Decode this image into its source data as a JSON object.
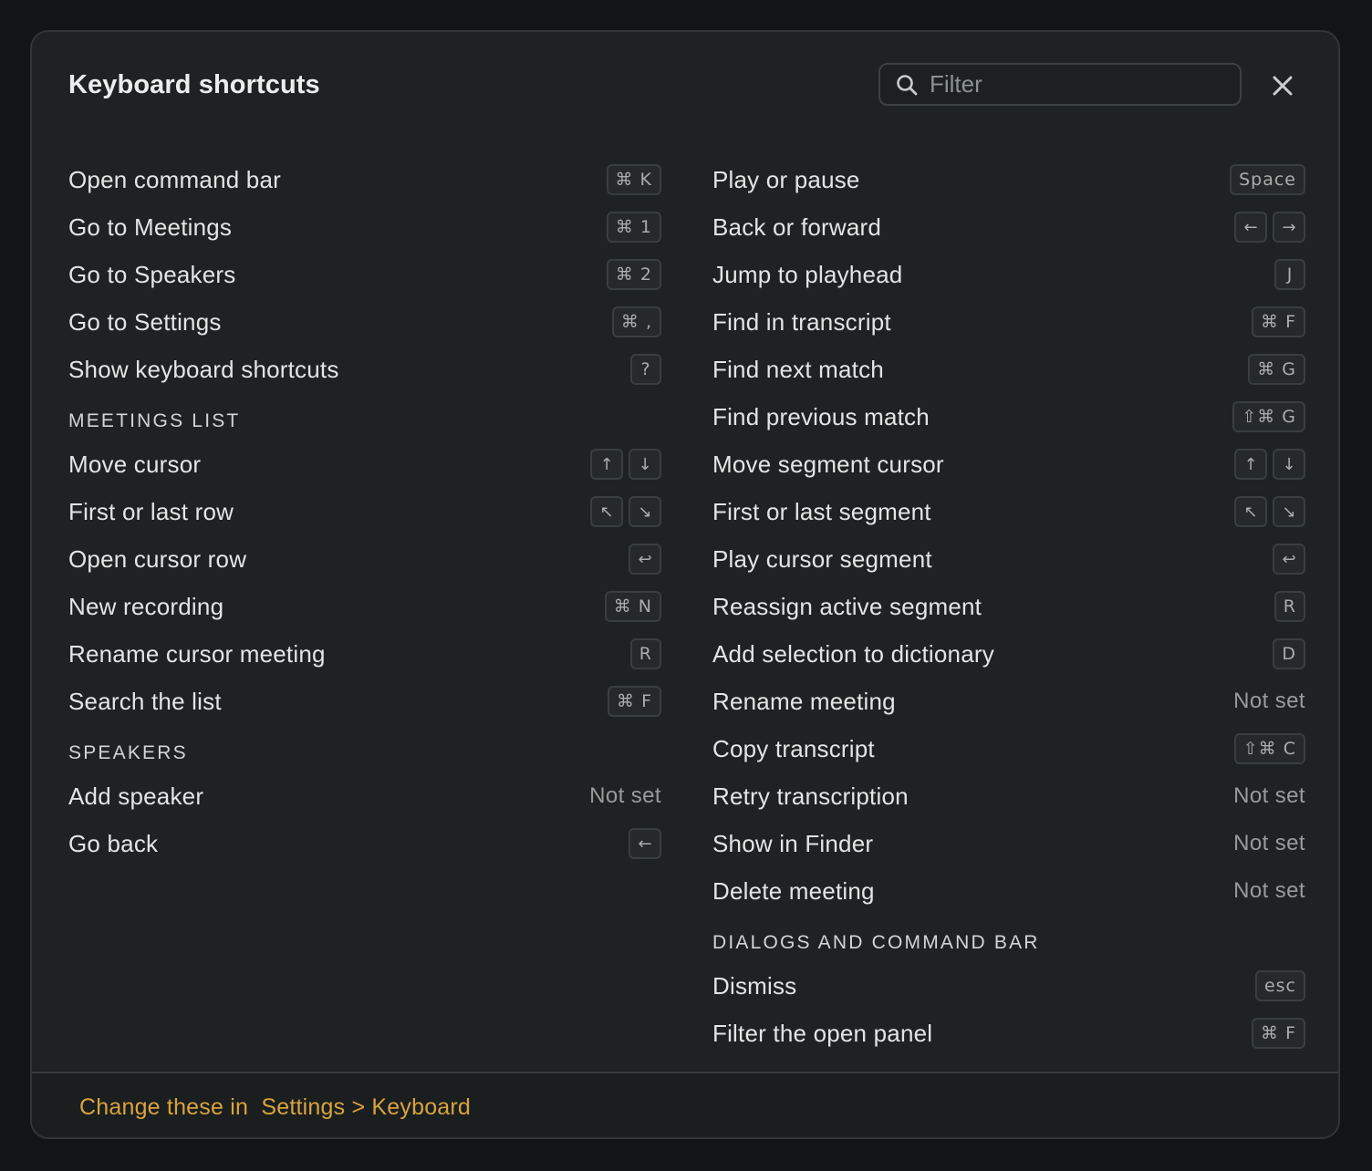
{
  "dialog": {
    "title": "Keyboard shortcuts",
    "filter_placeholder": "Filter",
    "close_icon": "close-icon",
    "search_icon": "search-icon"
  },
  "left_column": {
    "general": [
      {
        "action": "Open command bar",
        "keys": [
          "⌘ K"
        ]
      },
      {
        "action": "Go to Meetings",
        "keys": [
          "⌘ 1"
        ]
      },
      {
        "action": "Go to Speakers",
        "keys": [
          "⌘ 2"
        ]
      },
      {
        "action": "Go to Settings",
        "keys": [
          "⌘ ,"
        ]
      },
      {
        "action": "Show keyboard shortcuts",
        "keys": [
          "?"
        ]
      }
    ],
    "meetings_list": {
      "header": "MEETINGS LIST",
      "items": [
        {
          "action": "Move cursor",
          "keys": [
            "↑",
            "↓"
          ]
        },
        {
          "action": "First or last row",
          "keys": [
            "↖",
            "↘"
          ]
        },
        {
          "action": "Open cursor row",
          "keys": [
            "↩"
          ]
        },
        {
          "action": "New recording",
          "keys": [
            "⌘ N"
          ]
        },
        {
          "action": "Rename cursor meeting",
          "keys": [
            "R"
          ]
        },
        {
          "action": "Search the list",
          "keys": [
            "⌘ F"
          ]
        }
      ]
    },
    "speakers": {
      "header": "SPEAKERS",
      "items": [
        {
          "action": "Add speaker",
          "not_set": "Not set"
        },
        {
          "action": "Go back",
          "keys": [
            "←"
          ]
        }
      ]
    }
  },
  "right_column": {
    "meeting": [
      {
        "action": "Play or pause",
        "keys": [
          "Space"
        ]
      },
      {
        "action": "Back or forward",
        "keys": [
          "←",
          "→"
        ]
      },
      {
        "action": "Jump to playhead",
        "keys": [
          "J"
        ]
      },
      {
        "action": "Find in transcript",
        "keys": [
          "⌘ F"
        ]
      },
      {
        "action": "Find next match",
        "keys": [
          "⌘ G"
        ]
      },
      {
        "action": "Find previous match",
        "keys": [
          "⇧⌘ G"
        ]
      },
      {
        "action": "Move segment cursor",
        "keys": [
          "↑",
          "↓"
        ]
      },
      {
        "action": "First or last segment",
        "keys": [
          "↖",
          "↘"
        ]
      },
      {
        "action": "Play cursor segment",
        "keys": [
          "↩"
        ]
      },
      {
        "action": "Reassign active segment",
        "keys": [
          "R"
        ]
      },
      {
        "action": "Add selection to dictionary",
        "keys": [
          "D"
        ]
      },
      {
        "action": "Rename meeting",
        "not_set": "Not set"
      },
      {
        "action": "Copy transcript",
        "keys": [
          "⇧⌘ C"
        ]
      },
      {
        "action": "Retry transcription",
        "not_set": "Not set"
      },
      {
        "action": "Show in Finder",
        "not_set": "Not set"
      },
      {
        "action": "Delete meeting",
        "not_set": "Not set"
      }
    ],
    "dialogs": {
      "header": "DIALOGS AND COMMAND BAR",
      "items": [
        {
          "action": "Dismiss",
          "keys": [
            "esc"
          ]
        },
        {
          "action": "Filter the open panel",
          "keys": [
            "⌘ F"
          ]
        }
      ]
    }
  },
  "footer": {
    "prefix": "Change these in ",
    "link": "Settings > Keyboard"
  },
  "colors": {
    "background": "#121515",
    "dialog": "#1f2222",
    "accent": "#d9a33f",
    "text": "#e3e5e4",
    "muted": "#979c9a"
  }
}
